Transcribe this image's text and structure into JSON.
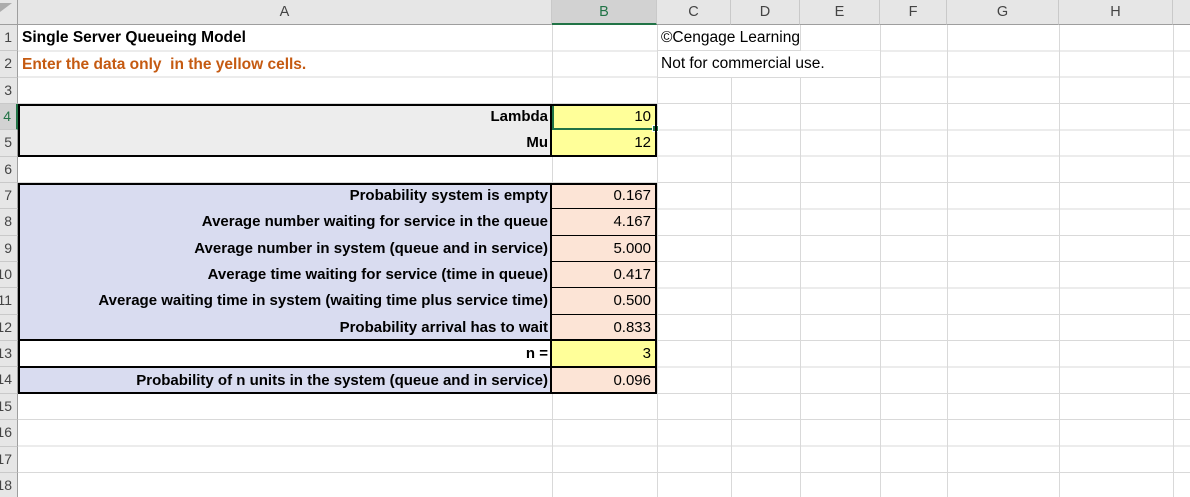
{
  "grid": {
    "column_headers": [
      "A",
      "B",
      "C",
      "D",
      "E",
      "F",
      "G",
      "H"
    ],
    "row_headers": [
      "1",
      "2",
      "3",
      "4",
      "5",
      "6",
      "7",
      "8",
      "9",
      "10",
      "11",
      "12",
      "13",
      "14",
      "15",
      "16",
      "17",
      "18"
    ],
    "selected_cell": "B4"
  },
  "sheet": {
    "title_cell": "Single Server Queueing Model",
    "instruction_cell": "Enter the data only  in the yellow cells.",
    "copyright_line1": "©Cengage Learning",
    "copyright_line2": "Not for commercial use.",
    "inputs": {
      "lambda_label": "Lambda",
      "lambda_value": "10",
      "mu_label": "Mu",
      "mu_value": "12",
      "n_label": "n =",
      "n_value": "3"
    },
    "results": [
      {
        "label": "Probability system is empty",
        "value": "0.167"
      },
      {
        "label": "Average number waiting for service in the queue",
        "value": "4.167"
      },
      {
        "label": "Average number in system (queue and in service)",
        "value": "5.000"
      },
      {
        "label": "Average time waiting for service (time in queue)",
        "value": "0.417"
      },
      {
        "label": "Average waiting time in system (waiting time plus service time)",
        "value": "0.500"
      },
      {
        "label": "Probability arrival has to wait",
        "value": "0.833"
      },
      {
        "label": "Probability of n units in the system (queue and in service)",
        "value": "0.096"
      }
    ]
  },
  "colors": {
    "input_fill": "#FFFF99",
    "result_fill": "#FCE4D6",
    "label_fill": "#D9DCF0",
    "block_gray_fill": "#EDEDED",
    "instruction_text": "#C55A11",
    "selection_green": "#217346",
    "grid_line": "#D9D9D9",
    "header_bg": "#E6E6E6",
    "header_selected_bg": "#D2D2D2",
    "header_border": "#9E9E9E"
  }
}
